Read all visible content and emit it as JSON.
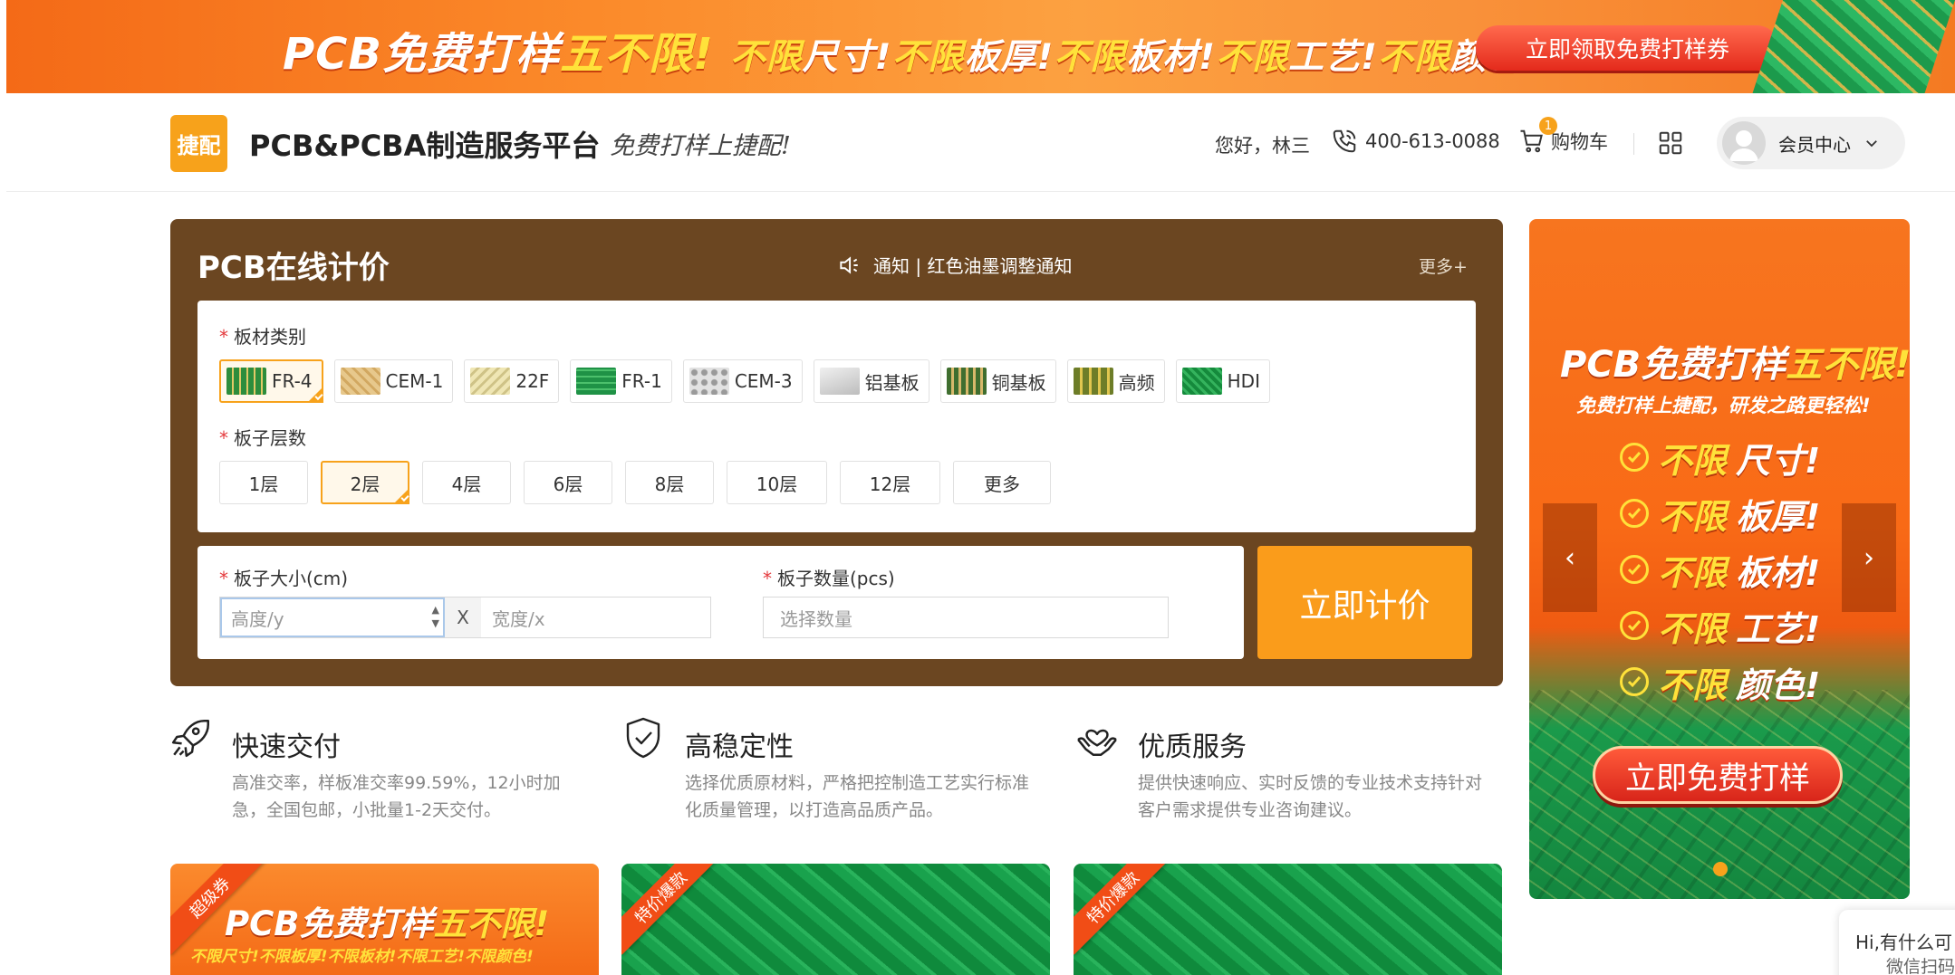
{
  "top_banner": {
    "headline_pcb": "PCB免费打样",
    "headline_hl": "五不限!",
    "items": [
      {
        "hl": "不限",
        "text": "尺寸!"
      },
      {
        "hl": "不限",
        "text": "板厚!"
      },
      {
        "hl": "不限",
        "text": "板材!"
      },
      {
        "hl": "不限",
        "text": "工艺!"
      },
      {
        "hl": "不限",
        "text": "颜色!"
      }
    ],
    "cta": "立即领取免费打样券"
  },
  "header": {
    "logo_text": "捷配",
    "brand": "PCB&PCBA制造服务平台",
    "slogan": "免费打样上捷配!",
    "greeting": "您好，林三",
    "phone": "400-613-0088",
    "cart_label": "购物车",
    "cart_count": "1",
    "member_label": "会员中心"
  },
  "quote": {
    "title": "PCB在线计价",
    "notice": "通知 | 红色油墨调整通知",
    "more": "更多+",
    "material_label": "板材类别",
    "materials": [
      "FR-4",
      "CEM-1",
      "22F",
      "FR-1",
      "CEM-3",
      "铝基板",
      "铜基板",
      "高频",
      "HDI"
    ],
    "selected_material": "FR-4",
    "layers_label": "板子层数",
    "layers": [
      "1层",
      "2层",
      "4层",
      "6层",
      "8层",
      "10层",
      "12层",
      "更多"
    ],
    "selected_layer": "2层",
    "size_label": "板子大小(cm)",
    "height_placeholder": "高度/y",
    "size_x": "X",
    "width_placeholder": "宽度/x",
    "qty_label": "板子数量(pcs)",
    "qty_placeholder": "选择数量",
    "calc_button": "立即计价",
    "required_mark": "*"
  },
  "features": [
    {
      "title": "快速交付",
      "desc": "高准交率，样板准交率99.59%，12小时加急，全国包邮，小批量1-2天交付。",
      "icon": "rocket-icon"
    },
    {
      "title": "高稳定性",
      "desc": "选择优质原材料，严格把控制造工艺实行标准化质量管理，以打造高品质产品。",
      "icon": "shield-check-icon"
    },
    {
      "title": "优质服务",
      "desc": "提供快速响应、实时反馈的专业技术支持针对客户需求提供专业咨询建议。",
      "icon": "heart-hand-icon"
    }
  ],
  "cards": [
    {
      "ribbon": "超级券",
      "title_pcb": "PCB免费打样",
      "title_hl": "五不限!",
      "sub": "不限尺寸!不限板厚!不限板材!不限工艺!不限颜色!"
    },
    {
      "ribbon": "特价爆款"
    },
    {
      "ribbon": "特价爆款"
    }
  ],
  "side_ad": {
    "title_pcb": "PCB免费打样",
    "title_hl": "五不限!",
    "subtitle": "免费打样上捷配，研发之路更轻松!",
    "items": [
      {
        "hl": "不限",
        "text": "尺寸!"
      },
      {
        "hl": "不限",
        "text": "板厚!"
      },
      {
        "hl": "不限",
        "text": "板材!"
      },
      {
        "hl": "不限",
        "text": "工艺!"
      },
      {
        "hl": "不限",
        "text": "颜色!"
      }
    ],
    "cta": "立即免费打样",
    "prev": "‹",
    "next": "›"
  },
  "chat": {
    "line1": "Hi,有什么可",
    "line2": "微信扫码"
  },
  "colors": {
    "accent": "#f7a21b",
    "panel": "#6b4621",
    "cta": "#fa9c1b"
  }
}
